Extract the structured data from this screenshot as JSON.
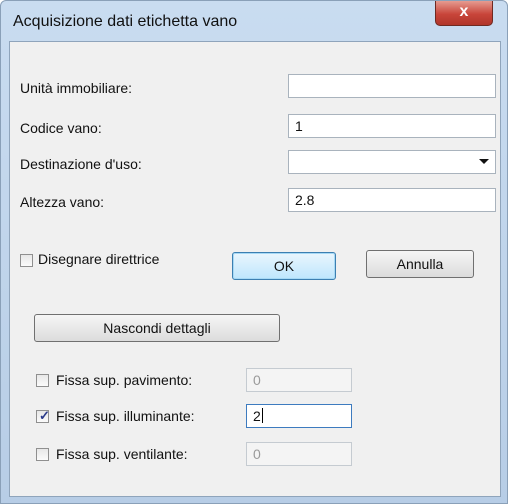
{
  "window": {
    "title": "Acquisizione dati etichetta vano",
    "close_glyph": "x"
  },
  "fields": {
    "unita": {
      "label": "Unità immobiliare:",
      "value": ""
    },
    "codice": {
      "label": "Codice vano:",
      "value": "1"
    },
    "destinazione": {
      "label": "Destinazione d'uso:",
      "value": ""
    },
    "altezza": {
      "label": "Altezza vano:",
      "value": "2.8"
    }
  },
  "options": {
    "disegnare": {
      "label": "Disegnare direttrice",
      "checked": false
    }
  },
  "buttons": {
    "ok": "OK",
    "annulla": "Annulla",
    "nascondi": "Nascondi dettagli"
  },
  "details": {
    "pavimento": {
      "label": "Fissa sup. pavimento:",
      "checked": false,
      "value": "0",
      "enabled": false
    },
    "illuminante": {
      "label": "Fissa sup. illuminante:",
      "checked": true,
      "value": "2",
      "enabled": true
    },
    "ventilante": {
      "label": "Fissa sup. ventilante:",
      "checked": false,
      "value": "0",
      "enabled": false
    }
  }
}
